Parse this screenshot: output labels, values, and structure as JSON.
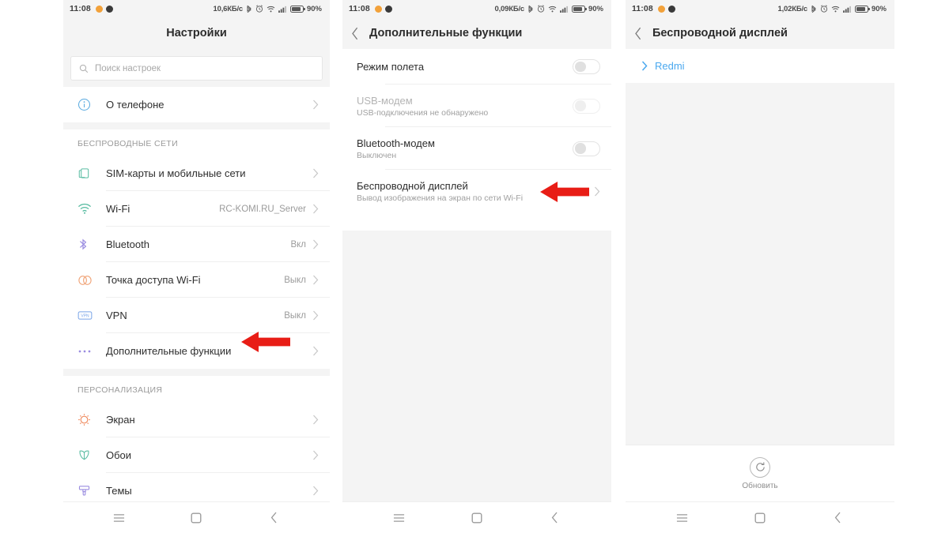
{
  "statusbar": {
    "time": "11:08",
    "battery_pct": "90%",
    "speed_1": "10,6КБ/c",
    "speed_2": "0,09КБ/c",
    "speed_3": "1,02КБ/c",
    "icons": [
      "bluetooth-icon",
      "alarm-icon",
      "wifi-icon",
      "signal-icon",
      "battery-icon"
    ]
  },
  "phone1": {
    "title": "Настройки",
    "search": {
      "placeholder": "Поиск настроек",
      "icon": "search-icon"
    },
    "rows_top": [
      {
        "label": "О телефоне",
        "icon": "info-icon",
        "value": "",
        "color": "#5aaae0"
      }
    ],
    "group_wireless": "БЕСПРОВОДНЫЕ СЕТИ",
    "rows_wireless": [
      {
        "label": "SIM-карты и мобильные сети",
        "icon": "sim-card-icon",
        "value": "",
        "color": "#5bbda3"
      },
      {
        "label": "Wi-Fi",
        "icon": "wifi-icon",
        "value": "RC-KOMI.RU_Server",
        "color": "#5bbda3"
      },
      {
        "label": "Bluetooth",
        "icon": "bluetooth-icon",
        "value": "Вкл",
        "color": "#9a8ce0"
      },
      {
        "label": "Точка доступа Wi-Fi",
        "icon": "hotspot-icon",
        "value": "Выкл",
        "color": "#f0a57a"
      },
      {
        "label": "VPN",
        "icon": "vpn-icon",
        "value": "Выкл",
        "color": "#7aa5e8"
      },
      {
        "label": "Дополнительные функции",
        "icon": "more-dots-icon",
        "value": "",
        "color": "#9a8ce0"
      }
    ],
    "group_personalization": "ПЕРСОНАЛИЗАЦИЯ",
    "rows_personalization": [
      {
        "label": "Экран",
        "icon": "brightness-icon",
        "value": "",
        "color": "#f08a5d"
      },
      {
        "label": "Обои",
        "icon": "wallpaper-icon",
        "value": "",
        "color": "#5bbda3"
      },
      {
        "label": "Темы",
        "icon": "theme-brush-icon",
        "value": "",
        "color": "#9a8ce0"
      }
    ]
  },
  "phone2": {
    "title": "Дополнительные функции",
    "back_icon": "back-chevron-icon",
    "rows": [
      {
        "label": "Режим полета",
        "sub": "",
        "control": "toggle",
        "state": "off",
        "dim": false
      },
      {
        "label": "USB-модем",
        "sub": "USB-подключения не обнаружено",
        "control": "toggle",
        "state": "off",
        "dim": true
      },
      {
        "label": "Bluetooth-модем",
        "sub": "Выключен",
        "control": "toggle",
        "state": "off",
        "dim": false
      },
      {
        "label": "Беспроводной дисплей",
        "sub": "Вывод изображения на экран по сети Wi-Fi",
        "control": "chevron",
        "state": "",
        "dim": false
      }
    ]
  },
  "phone3": {
    "title": "Беспроводной дисплей",
    "back_icon": "back-chevron-icon",
    "device": {
      "name": "Redmi",
      "icon": "chevron-right-icon",
      "color": "#4aa8ef"
    },
    "refresh": {
      "label": "Обновить",
      "icon": "refresh-icon"
    }
  },
  "navbar": {
    "menu_icon": "menu-icon",
    "home_icon": "home-square-icon",
    "back_icon": "back-chevron-icon"
  },
  "annotations": {
    "arrow_color": "#e81d16",
    "arrow1_target": "Дополнительные функции",
    "arrow2_target": "Беспроводной дисплей"
  }
}
